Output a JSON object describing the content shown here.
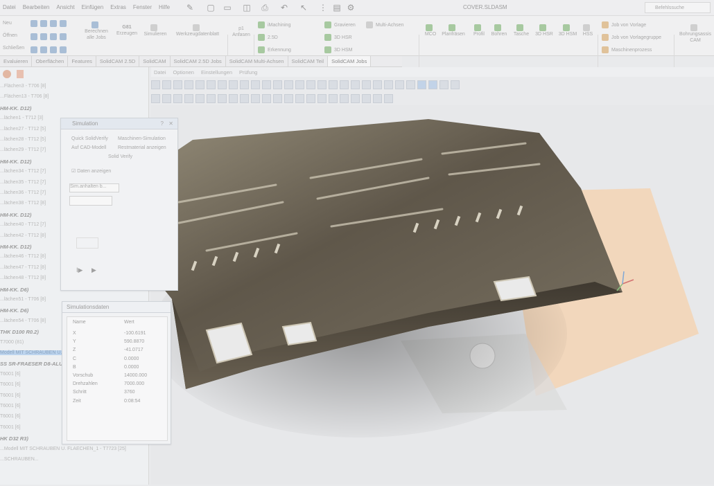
{
  "menu": [
    "Datei",
    "Bearbeiten",
    "Ansicht",
    "Einfügen",
    "Extras",
    "Fenster",
    "Hilfe"
  ],
  "document_title": "COVER.SLDASM",
  "search_placeholder": "Befehlssuche",
  "ribbon": {
    "left_labels": [
      "Neu",
      "Öffnen",
      "Schließen"
    ],
    "calc_jobs": "Berechnen alle Jobs",
    "g81": "G81",
    "generate": "Erzeugen",
    "simulate": "Simulieren",
    "tool_sheet": "Werkzeugdatenblatt",
    "p1": "p1",
    "attach": "Anfasen",
    "imachining": "iMachining",
    "d25": "2.5D",
    "recognize": "Erkennung",
    "engrave": "Gravieren",
    "hsr": "3D HSR",
    "hsm": "3D HSM",
    "multi": "Multi-Achsen",
    "mco": "MCO",
    "face": "Planfräsen",
    "profile": "Profil",
    "drill": "Bohren",
    "pocket": "Tasche",
    "hsr2": "3D HSR",
    "hsm2": "3D HSM",
    "hss": "HSS",
    "job_template": "Job von Vorlage",
    "job_template_group": "Job von Vorlagegruppe",
    "machine_process": "Maschinenprozess",
    "hole_assist": "Bohrungsassis CAM"
  },
  "tabs": [
    "Evaluieren",
    "Oberflächen",
    "Features",
    "SolidCAM 2.5D",
    "SolidCAM",
    "SolidCAM 2.5D Jobs",
    "SolidCAM Multi-Achsen",
    "SolidCAM Teil",
    "SolidCAM Jobs"
  ],
  "view_menu": [
    "Datei",
    "Optionen",
    "Einstellungen",
    "Prüfung"
  ],
  "tree": [
    {
      "text": "...Flächen3 - T706 [8]",
      "bold": false
    },
    {
      "text": "...Flächen13 - T706 [8]",
      "bold": false
    },
    {
      "text": "HM-KK. D12)",
      "bold": true
    },
    {
      "text": "...lächen1 - T712 [3]",
      "bold": false
    },
    {
      "text": "...lächen27 - T712 [5]",
      "bold": false
    },
    {
      "text": "...lächen28 - T712 [5]",
      "bold": false
    },
    {
      "text": "...lächen29 - T712 [7]",
      "bold": false
    },
    {
      "text": "HM-KK. D12)",
      "bold": true
    },
    {
      "text": "...lächen34 - T712 [7]",
      "bold": false
    },
    {
      "text": "...lächen35 - T712 [7]",
      "bold": false
    },
    {
      "text": "...lächen36 - T712 [7]",
      "bold": false
    },
    {
      "text": "...lächen38 - T712 [8]",
      "bold": false
    },
    {
      "text": "HM-KK. D12)",
      "bold": true
    },
    {
      "text": "...lächen40 - T712 [7]",
      "bold": false
    },
    {
      "text": "...lächen42 - T712 [8]",
      "bold": false
    },
    {
      "text": "HM-KK. D12)",
      "bold": true
    },
    {
      "text": "...lächen46 - T712 [8]",
      "bold": false
    },
    {
      "text": "...lächen47 - T712 [8]",
      "bold": false
    },
    {
      "text": "...lächen48 - T712 [8]",
      "bold": false
    },
    {
      "text": "HM-KK. D6)",
      "bold": true
    },
    {
      "text": "...lächen51 - T706 [8]",
      "bold": false
    },
    {
      "text": "HM-KK. D6)",
      "bold": true
    },
    {
      "text": "...lächen54 - T706 [8]",
      "bold": false
    },
    {
      "text": "THK D100 R0.2)",
      "bold": true
    },
    {
      "text": "T7000 (81)",
      "bold": false
    },
    {
      "text": "Modell MIT SCHRAUBEN U...",
      "bold": false,
      "selected": true
    },
    {
      "text": "SS SR-FRAESER D8-ALU)",
      "bold": true
    },
    {
      "text": "T6001 [6]",
      "bold": false
    },
    {
      "text": "T6001 [6]",
      "bold": false
    },
    {
      "text": "T6001 [6]",
      "bold": false
    },
    {
      "text": "T6001 [6]",
      "bold": false
    },
    {
      "text": "T6001 [6]",
      "bold": false
    },
    {
      "text": "T6001 [6]",
      "bold": false
    },
    {
      "text": "HK D32 R3)",
      "bold": true
    },
    {
      "text": "...Modell MIT SCHRAUBEN U. FLAECHEN_1 - T7723 [25]",
      "bold": false
    },
    {
      "text": "...SCHRAUBEN...",
      "bold": false
    }
  ],
  "sim_dialog": {
    "title": "Simulation",
    "quick": "Quick SolidVerify",
    "machine": "Maschinen-Simulation",
    "cad": "Auf CAD-Modell",
    "rest": "Restmaterial anzeigen",
    "solid": "Solid Verify",
    "show_data": "Daten anzeigen",
    "stop": "Sim.anhalten b..."
  },
  "sim_data": {
    "title": "Simulationsdaten",
    "col_name": "Name",
    "col_value": "Wert",
    "rows": [
      {
        "name": "X",
        "value": "-100.6191"
      },
      {
        "name": "Y",
        "value": "590.8870"
      },
      {
        "name": "Z",
        "value": "-41.0717"
      },
      {
        "name": "C",
        "value": "0.0000"
      },
      {
        "name": "B",
        "value": "0.0000"
      },
      {
        "name": "Vorschub",
        "value": "14000.000"
      },
      {
        "name": "Drehzahlen",
        "value": "7000.000"
      },
      {
        "name": "Schritt",
        "value": "3760"
      },
      {
        "name": "Zeit",
        "value": "0:08:54"
      }
    ]
  },
  "colors": {
    "part_metal": "#6b6252",
    "part_highlight": "#c9c2b0",
    "fixture": "#f3d3b4",
    "selection": "#bcd4ee"
  }
}
